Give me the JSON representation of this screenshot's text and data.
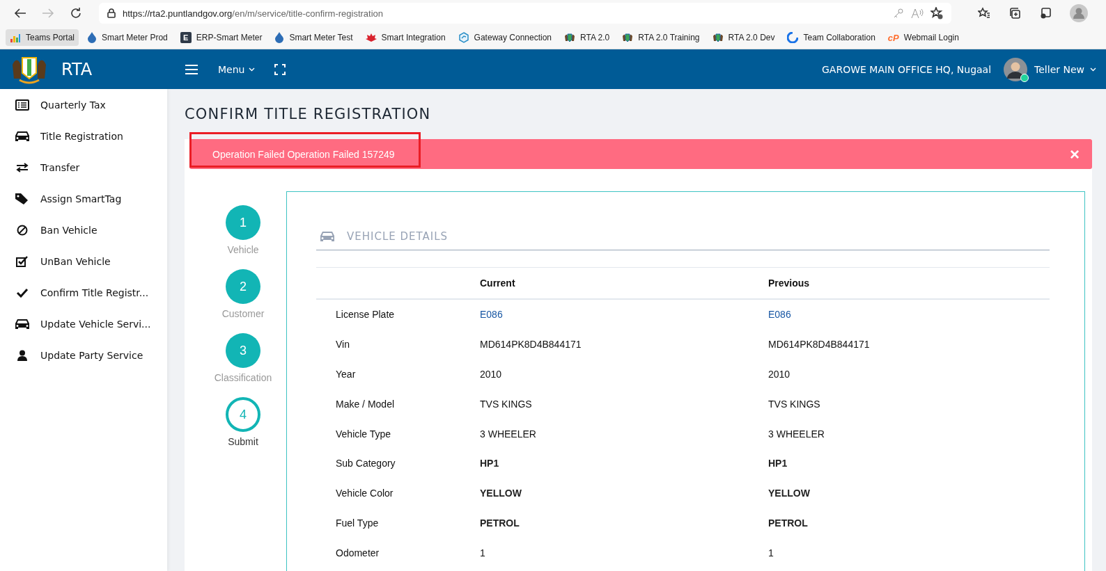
{
  "browser": {
    "url_host": "https://rta2.puntlandgov.org",
    "url_path": "/en/m/service/title-confirm-registration",
    "bookmarks": [
      {
        "label": "Teams Portal",
        "selected": true
      },
      {
        "label": "Smart Meter Prod",
        "selected": false
      },
      {
        "label": "ERP-Smart Meter",
        "selected": false
      },
      {
        "label": "Smart Meter Test",
        "selected": false
      },
      {
        "label": "Smart Integration",
        "selected": false
      },
      {
        "label": "Gateway Connection",
        "selected": false
      },
      {
        "label": "RTA 2.0",
        "selected": false
      },
      {
        "label": "RTA 2.0 Training",
        "selected": false
      },
      {
        "label": "RTA 2.0 Dev",
        "selected": false
      },
      {
        "label": "Team Collaboration",
        "selected": false
      },
      {
        "label": "Webmail Login",
        "selected": false
      }
    ],
    "letter_icon_text": "E",
    "cp_icon_text": "cP"
  },
  "header": {
    "brand": "RTA",
    "menu": "Menu",
    "office": "GAROWE MAIN OFFICE HQ, Nugaal",
    "user": "Teller New",
    "online": true
  },
  "sidebar": {
    "items": [
      {
        "label": "Quarterly Tax"
      },
      {
        "label": "Title Registration"
      },
      {
        "label": "Transfer"
      },
      {
        "label": "Assign SmartTag"
      },
      {
        "label": "Ban Vehicle"
      },
      {
        "label": "UnBan Vehicle"
      },
      {
        "label": "Confirm Title Registr..."
      },
      {
        "label": "Update Vehicle Servi..."
      },
      {
        "label": "Update Party Service"
      }
    ]
  },
  "page_title": "CONFIRM TITLE REGISTRATION",
  "alert": {
    "message": "Operation Failed Operation Failed 157249",
    "close": "×",
    "highlighted": true
  },
  "steps": [
    {
      "number": "1",
      "label": "Vehicle",
      "selected": false
    },
    {
      "number": "2",
      "label": "Customer",
      "selected": false
    },
    {
      "number": "3",
      "label": "Classification",
      "selected": false
    },
    {
      "number": "4",
      "label": "Submit",
      "selected": true
    }
  ],
  "details": {
    "title": "VEHICLE DETAILS",
    "columns": [
      "Current",
      "Previous"
    ],
    "rows": [
      {
        "label": "License Plate",
        "current": "E086",
        "previous": "E086",
        "kind": "link"
      },
      {
        "label": "Vin",
        "current": "MD614PK8D4B844171",
        "previous": "MD614PK8D4B844171",
        "kind": "text"
      },
      {
        "label": "Year",
        "current": "2010",
        "previous": "2010",
        "kind": "text"
      },
      {
        "label": "Make / Model",
        "current": "TVS KINGS",
        "previous": "TVS KINGS",
        "kind": "text"
      },
      {
        "label": "Vehicle Type",
        "current": "3 WHEELER",
        "previous": "3 WHEELER",
        "kind": "text"
      },
      {
        "label": "Sub Category",
        "current": "HP1",
        "previous": "HP1",
        "kind": "strong"
      },
      {
        "label": "Vehicle Color",
        "current": "YELLOW",
        "previous": "YELLOW",
        "kind": "strong"
      },
      {
        "label": "Fuel Type",
        "current": "PETROL",
        "previous": "PETROL",
        "kind": "strong"
      },
      {
        "label": "Odometer",
        "current": "1",
        "previous": "1",
        "kind": "text"
      }
    ]
  }
}
